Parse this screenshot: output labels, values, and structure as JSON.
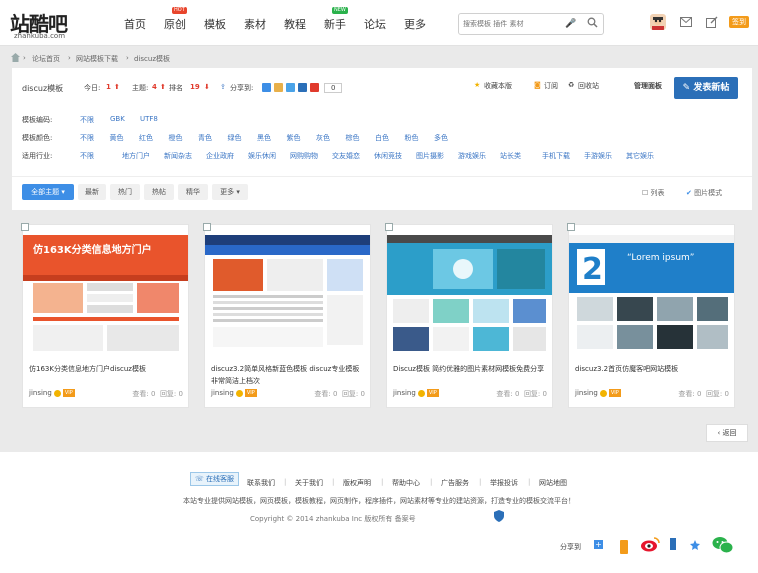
{
  "header": {
    "logo_text": "站酷吧",
    "logo_subtext": "zhankuba.com",
    "nav": [
      {
        "label": "首页",
        "badge": ""
      },
      {
        "label": "原创",
        "badge": "HOT"
      },
      {
        "label": "模板",
        "badge": ""
      },
      {
        "label": "素材",
        "badge": ""
      },
      {
        "label": "教程",
        "badge": ""
      },
      {
        "label": "新手",
        "badge": "NEW"
      },
      {
        "label": "论坛",
        "badge": ""
      },
      {
        "label": "更多",
        "badge": ""
      }
    ],
    "search_placeholder": "搜索模板 插件 素材",
    "user_badge": "签到"
  },
  "breadcrumb": [
    "论坛首页",
    "网站模板下载",
    "discuz模板"
  ],
  "forum": {
    "name": "discuz模板",
    "today_label": "今日:",
    "today_value": "1",
    "topics_label": "主题:",
    "topics_value": "4",
    "rank_label": "排名",
    "rank_value": "19",
    "share_label": "分享到:",
    "share_count": "0",
    "favorite_label": "收藏本版",
    "rss_label": "订阅",
    "recycle_label": "回收站",
    "admin_label": "管理面板",
    "post_button": "发表新帖"
  },
  "filters": [
    {
      "label": "模板编码:",
      "options": [
        "不限",
        "GBK",
        "UTF8"
      ]
    },
    {
      "label": "模板颜色:",
      "options": [
        "不限",
        "黄色",
        "红色",
        "橙色",
        "青色",
        "绿色",
        "黑色",
        "紫色",
        "灰色",
        "棕色",
        "白色",
        "粉色",
        "多色"
      ]
    },
    {
      "label": "适用行业:",
      "options": [
        "不限",
        "地方门户",
        "新闻杂志",
        "企业政府",
        "娱乐休闲",
        "网购购物",
        "交友婚恋",
        "休闲竞技",
        "图片摄影",
        "游戏娱乐",
        "站长类",
        "手机下载",
        "手游娱乐",
        "其它娱乐"
      ]
    }
  ],
  "tabs": [
    "全部主题",
    "最新",
    "热门",
    "热帖",
    "精华",
    "更多"
  ],
  "view_modes": {
    "list": "列表",
    "image": "图片模式"
  },
  "cards": [
    {
      "title": "仿163K分类信息地方门户discuz模板",
      "author": "jinsing",
      "views_label": "查看:",
      "views": "0",
      "replies_label": "回复:",
      "replies": "0",
      "thumb_headline": "仿163K分类信息地方门户",
      "thumb_color": "#e9542c"
    },
    {
      "title": "discuz3.2简单风格新蓝色模板 discuz专业模板 非常简洁上档次",
      "author": "jinsing",
      "views_label": "查看:",
      "views": "0",
      "replies_label": "回复:",
      "replies": "0",
      "thumb_headline": "",
      "thumb_color": "#2a68c8"
    },
    {
      "title": "Discuz模板 简约优雅的图片素材网模板免费分享",
      "author": "jinsing",
      "views_label": "查看:",
      "views": "0",
      "replies_label": "回复:",
      "replies": "0",
      "thumb_headline": "",
      "thumb_color": "#2c9ec9"
    },
    {
      "title": "discuz3.2首页仿魔客吧网站模板",
      "author": "jinsing",
      "views_label": "查看:",
      "views": "0",
      "replies_label": "回复:",
      "replies": "0",
      "thumb_headline": "Lorem ipsum",
      "thumb_color": "#1f7fc9"
    }
  ],
  "pager": {
    "back_label": "返回"
  },
  "footer": {
    "service_label": "在线客服",
    "links": [
      "联系我们",
      "关于我们",
      "版权声明",
      "帮助中心",
      "广告服务",
      "举报投诉",
      "网站地图"
    ],
    "intro": "本站专业提供网站模板，网页模板，模板教程，网页制作，程序插件，网站素材等专业的建站资源，打造专业的模板交流平台！",
    "copyright": "Copyright © 2014 zhankuba Inc 版权所有 备案号",
    "share_label": "分享到"
  },
  "colors": {
    "accent": "#2b6fb8",
    "tab_active": "#3d8ee6",
    "hot": "#e8452c",
    "new": "#2bb24c",
    "vip": "#f39b1a"
  }
}
